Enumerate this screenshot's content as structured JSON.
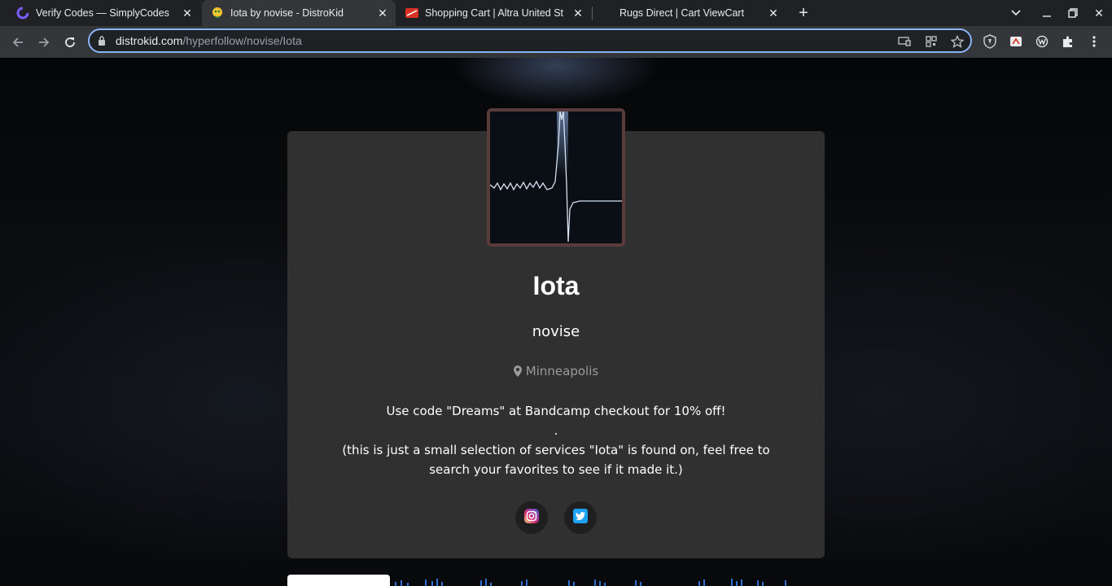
{
  "browser": {
    "tabs": [
      {
        "title": "Verify Codes — SimplyCodes",
        "favicon": "simplycodes-icon",
        "active": false
      },
      {
        "title": "Iota by novise - DistroKid",
        "favicon": "distrokid-icon",
        "active": true
      },
      {
        "title": "Shopping Cart | Altra United States",
        "favicon": "altra-icon",
        "active": false
      },
      {
        "title": "Rugs Direct | Cart ViewCart",
        "favicon": "",
        "active": false
      }
    ],
    "url_host": "distrokid.com",
    "url_path": "/hyperfollow/novise/Iota",
    "accent_color": "#8ab4f8"
  },
  "release": {
    "title": "Iota",
    "artist": "novise",
    "location": "Minneapolis",
    "description_line1": "Use code \"Dreams\" at Bandcamp checkout for 10% off!",
    "description_line2": ".",
    "description_line3": "(this is just a small selection of services \"Iota\" is found on, feel free to search your favorites to see if it made it.)"
  },
  "social": [
    {
      "name": "instagram",
      "icon": "instagram-icon"
    },
    {
      "name": "twitter",
      "icon": "twitter-icon"
    }
  ],
  "colors": {
    "card_bg": "#303030",
    "artwork_border": "#5a3b3b",
    "twitter_blue": "#1da1f2"
  }
}
